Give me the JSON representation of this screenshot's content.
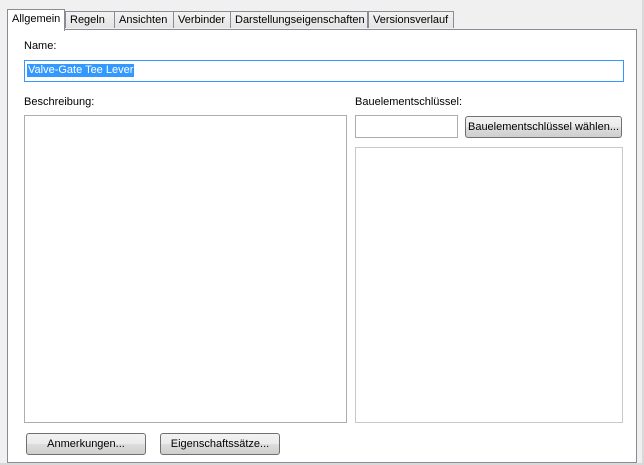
{
  "tabs": [
    {
      "label": "Allgemein",
      "active": true
    },
    {
      "label": "Regeln"
    },
    {
      "label": "Ansichten"
    },
    {
      "label": "Verbinder"
    },
    {
      "label": "Darstellungseigenschaften"
    },
    {
      "label": "Versionsverlauf"
    }
  ],
  "name": {
    "label": "Name:",
    "value": "Valve-Gate Tee Lever"
  },
  "description": {
    "label": "Beschreibung:",
    "value": ""
  },
  "component_key": {
    "label": "Bauelementschlüssel:",
    "value": "",
    "choose_button": "Bauelementschlüssel wählen..."
  },
  "buttons": {
    "notes": "Anmerkungen...",
    "property_sets": "Eigenschaftssätze..."
  }
}
